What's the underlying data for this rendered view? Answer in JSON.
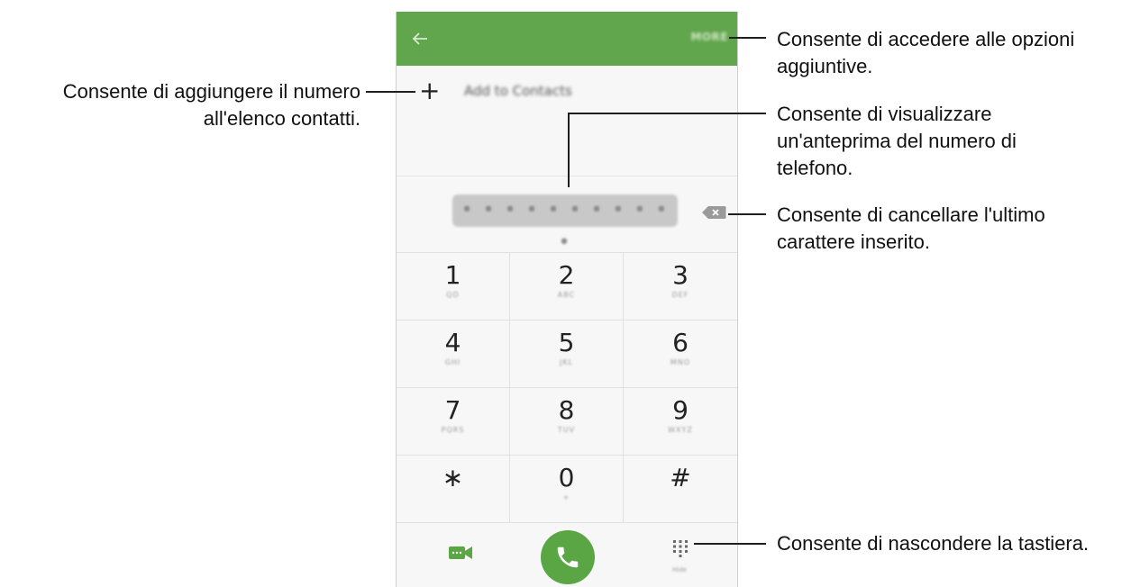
{
  "appbar": {
    "more_label": "MORE"
  },
  "add_contact": {
    "plus": "+",
    "label": "Add to Contacts"
  },
  "number_preview": {
    "value": "• • • • • • • • • • •"
  },
  "keypad": {
    "keys": [
      {
        "digit": "1",
        "letters": "QD"
      },
      {
        "digit": "2",
        "letters": "ABC"
      },
      {
        "digit": "3",
        "letters": "DEF"
      },
      {
        "digit": "4",
        "letters": "GHI"
      },
      {
        "digit": "5",
        "letters": "JKL"
      },
      {
        "digit": "6",
        "letters": "MNO"
      },
      {
        "digit": "7",
        "letters": "PQRS"
      },
      {
        "digit": "8",
        "letters": "TUV"
      },
      {
        "digit": "9",
        "letters": "WXYZ"
      },
      {
        "digit": "∗",
        "letters": ""
      },
      {
        "digit": "0",
        "letters": "+"
      },
      {
        "digit": "#",
        "letters": ""
      }
    ]
  },
  "bottom": {
    "hide_label": "Hide"
  },
  "colors": {
    "appbar": "#61a54c",
    "call_button": "#5aa644",
    "video": "#5aa644"
  },
  "icons": [
    "back-arrow-icon",
    "plus-icon",
    "backspace-icon",
    "video-call-icon",
    "phone-icon",
    "dialpad-icon"
  ],
  "annotations": {
    "more_options_1": "Consente di accedere alle opzioni",
    "more_options_2": "aggiuntive.",
    "add_contacts_1": "Consente di aggiungere il numero",
    "add_contacts_2": "all'elenco contatti.",
    "preview_1": "Consente di visualizzare",
    "preview_2": "un'anteprima del numero di",
    "preview_3": "telefono.",
    "delete_1": "Consente di cancellare l'ultimo",
    "delete_2": "carattere inserito.",
    "hide_keypad": "Consente di nascondere la tastiera."
  }
}
